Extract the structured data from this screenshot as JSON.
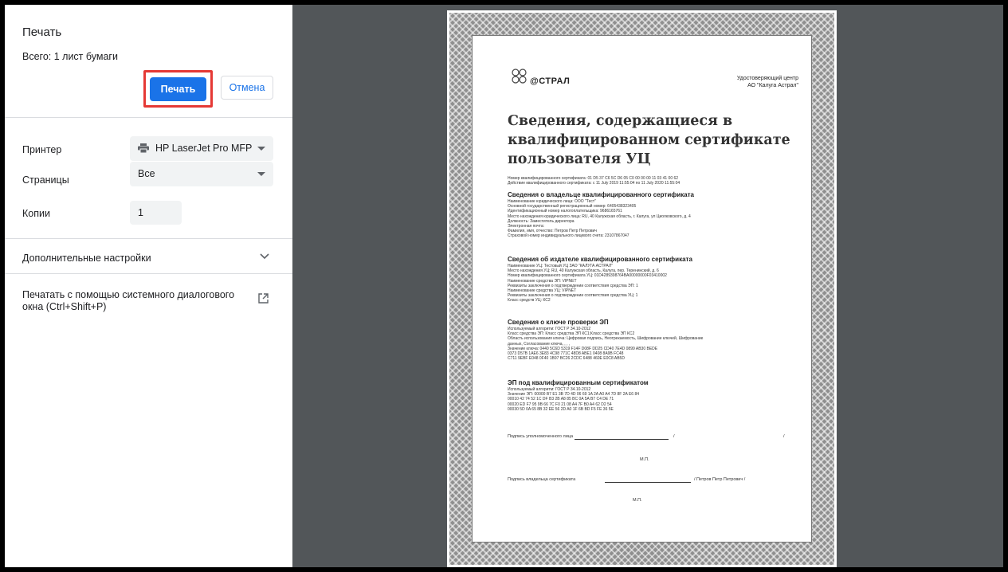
{
  "panel": {
    "title": "Печать",
    "sheet_count": "Всего: 1 лист бумаги",
    "print_button": "Печать",
    "cancel_button": "Отмена",
    "printer_label": "Принтер",
    "printer_value": "HP LaserJet Pro MFP",
    "pages_label": "Страницы",
    "pages_value": "Все",
    "copies_label": "Копии",
    "copies_value": "1",
    "advanced_label": "Дополнительные настройки",
    "system_dialog_label": "Печатать с помощью системного диалогового окна (Ctrl+Shift+P)"
  },
  "preview": {
    "logo_text": "@СТРАЛ",
    "ca_line1": "Удостоверяющий центр",
    "ca_line2": "АО \"Калуга Астрал\"",
    "title": "Сведения, содержащиеся в квалифицированном сертификате пользователя УЦ",
    "cert_number": "Номер квалифицированного сертификата: 01 D5 37 C6 5C D6 05 C0 00 00 00 11 03 41 00 62",
    "cert_validity": "Действие квалифицированного сертификата: с 11 July 2019 11:55:04 по 11 July 2020 11:55:04",
    "owner_heading": "Сведения о владельце квалифицированного сертификата",
    "owner_lines": [
      "Наименование юридического лица: ООО \"Тест\"",
      "Основной государственный регистрационный номер: 6405438323405",
      "Идентификационный номер налогоплательщика: 9686165761",
      "Место нахождения юридического лица: RU, 40 Калужская область, г. Калуга, ул Циолковского, д. 4",
      "Должность: Заместитель директора",
      "Электронная почта:",
      "Фамилия, имя, отчество: Петров Петр Петрович",
      "Страховой номер индивидуального лицевого счета: 23107867047"
    ],
    "issuer_heading": "Сведения об издателе квалифицированного сертификата",
    "issuer_lines": [
      "Наименование УЦ: Тестовый УЦ ЗАО \"КАЛУГА АСТРАЛ\"",
      "Место нахождения УЦ: RU, 40 Калужская область, Калуга, пер. Теренинский, д. 6",
      "Номер квалифицированного сертификата УЦ: 01D4289398764BA00000000F03410002",
      "Наименование средства ЭП: VIPNET",
      "Реквизиты заключения о подтверждении соответствия средства ЭП: 1",
      "Наименование средства УЦ: VIPNET",
      "Реквизиты заключения о подтверждении соответствия средства УЦ: 1",
      "Класс средств УЦ: КС2"
    ],
    "key_heading": "Сведения о ключе проверки ЭП",
    "key_lines": [
      "Используемый алгоритм: ГОСТ Р 34.10-2012",
      "Класс средства ЭП: Класс средства ЭП КС1;Класс средства ЭП КС2",
      "Область использования ключа: Цифровая подпись, Неотрекаемость, Шифрование ключей, Шифрование",
      "данных, Согласование ключа, , , ,",
      "Значение ключа: 0440 5C6D 5319 F14F D08F DD25 CD40 7E4D 0899 AB30 BEDE",
      "0373 D57B 1AE6 3E83 4C98 771C 48D8 ABE1 0408 8A9B FC48",
      "C711 9EBF E048 0F40 1B97 BC26 2CDC 6488 460E E0C8 AB5D"
    ],
    "sig_heading": "ЭП под квалифицированным сертификатом",
    "sig_lines": [
      "Используемый алгоритм: ГОСТ Р 34.10-2012",
      "Значение ЭП: 00000 B7 E1 3B 7D 4D 06 69 1A 2A A0 A4 7D 8F 2A E6 84",
      "00010 42 74 52 1C DF B3 2B A8 85 BC 0A 5A B7 C4 DE 71",
      "00020 ED F7 95 9B 66 7C F0 21 08 A4 7F B0 A4 62 D2 54",
      "00030 5D 0A 65 8B 32 EE 56 2D A0 1F 6B BD F5 FE 36 5E"
    ],
    "authorized_sign": "Подпись уполномоченного лица",
    "seal1": "М.П.",
    "owner_sign": "Подпись владельца сертификата",
    "owner_name": "/ Петров Петр Петрович /",
    "seal2": "М.П."
  },
  "colors": {
    "accent": "#1a73e8",
    "highlight_border": "#e53935",
    "preview_bg": "#525659"
  }
}
